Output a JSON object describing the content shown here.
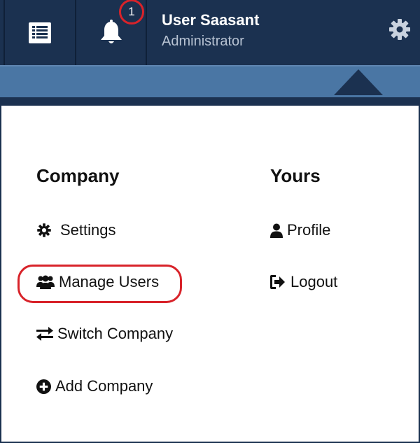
{
  "header": {
    "notification_count": "1",
    "user_name": "User Saasant",
    "user_role": "Administrator"
  },
  "menu": {
    "company": {
      "heading": "Company",
      "items": [
        {
          "label": "Settings",
          "icon": "gear-icon"
        },
        {
          "label": "Manage Users",
          "icon": "users-icon"
        },
        {
          "label": "Switch Company",
          "icon": "switch-arrows-icon"
        },
        {
          "label": "Add Company",
          "icon": "plus-circle-icon"
        }
      ]
    },
    "yours": {
      "heading": "Yours",
      "items": [
        {
          "label": "Profile",
          "icon": "user-icon"
        },
        {
          "label": "Logout",
          "icon": "sign-out-icon"
        }
      ]
    }
  },
  "colors": {
    "header_bg": "#1b3150",
    "band_bg": "#4a76a4",
    "highlight": "#d8232a"
  }
}
